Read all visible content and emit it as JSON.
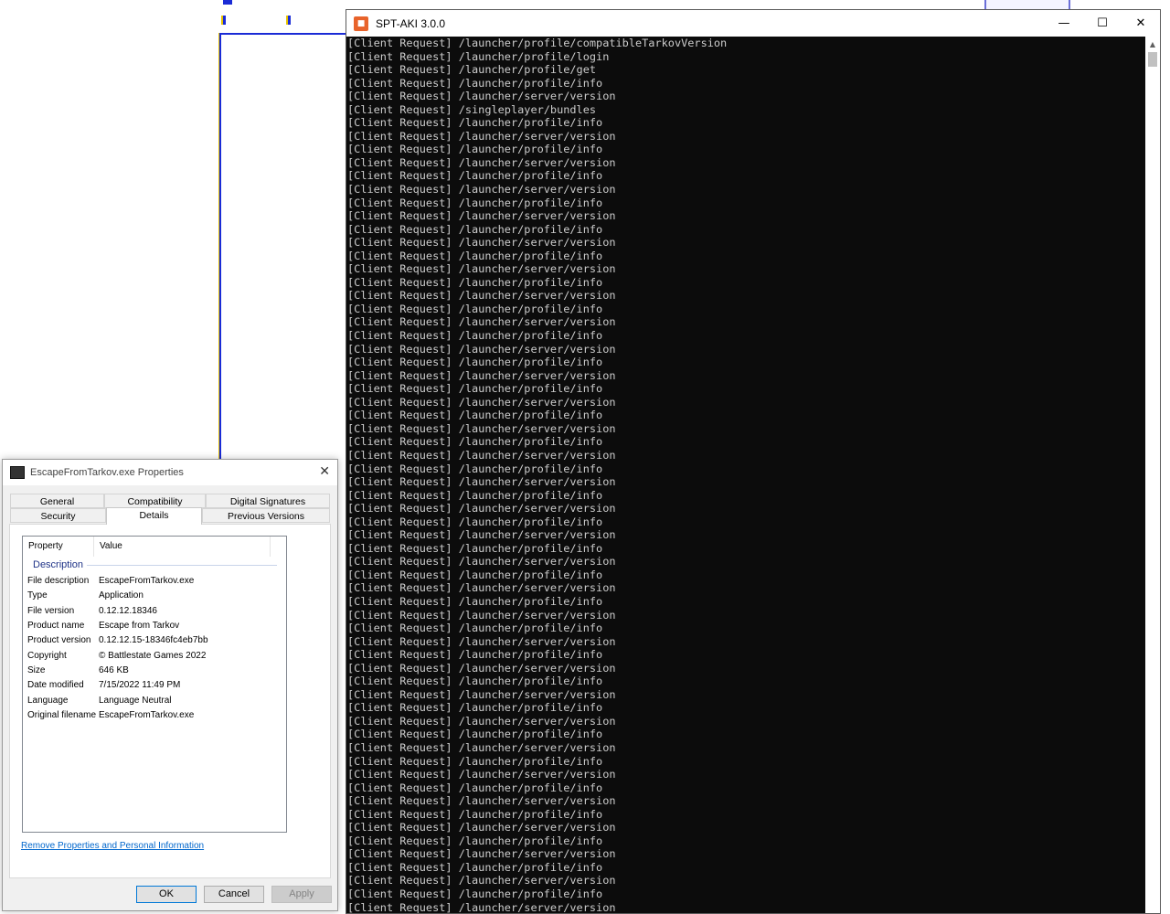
{
  "colors": {
    "console_bg": "#0c0c0c",
    "console_text": "#cccccc",
    "link": "#0066cc",
    "group": "#1e3287"
  },
  "console": {
    "title": "SPT-AKI 3.0.0",
    "icon": "spt-aki-icon",
    "controls": {
      "minimize": "—",
      "maximize": "☐",
      "close": "✕"
    },
    "lines": [
      "[Client Request] /launcher/profile/compatibleTarkovVersion",
      "[Client Request] /launcher/profile/login",
      "[Client Request] /launcher/profile/get",
      "[Client Request] /launcher/profile/info",
      "[Client Request] /launcher/server/version",
      "[Client Request] /singleplayer/bundles",
      "[Client Request] /launcher/profile/info",
      "[Client Request] /launcher/server/version",
      "[Client Request] /launcher/profile/info",
      "[Client Request] /launcher/server/version",
      "[Client Request] /launcher/profile/info",
      "[Client Request] /launcher/server/version",
      "[Client Request] /launcher/profile/info",
      "[Client Request] /launcher/server/version",
      "[Client Request] /launcher/profile/info",
      "[Client Request] /launcher/server/version",
      "[Client Request] /launcher/profile/info",
      "[Client Request] /launcher/server/version",
      "[Client Request] /launcher/profile/info",
      "[Client Request] /launcher/server/version",
      "[Client Request] /launcher/profile/info",
      "[Client Request] /launcher/server/version",
      "[Client Request] /launcher/profile/info",
      "[Client Request] /launcher/server/version",
      "[Client Request] /launcher/profile/info",
      "[Client Request] /launcher/server/version",
      "[Client Request] /launcher/profile/info",
      "[Client Request] /launcher/server/version",
      "[Client Request] /launcher/profile/info",
      "[Client Request] /launcher/server/version",
      "[Client Request] /launcher/profile/info",
      "[Client Request] /launcher/server/version",
      "[Client Request] /launcher/profile/info",
      "[Client Request] /launcher/server/version",
      "[Client Request] /launcher/profile/info",
      "[Client Request] /launcher/server/version",
      "[Client Request] /launcher/profile/info",
      "[Client Request] /launcher/server/version",
      "[Client Request] /launcher/profile/info",
      "[Client Request] /launcher/server/version",
      "[Client Request] /launcher/profile/info",
      "[Client Request] /launcher/server/version",
      "[Client Request] /launcher/profile/info",
      "[Client Request] /launcher/server/version",
      "[Client Request] /launcher/profile/info",
      "[Client Request] /launcher/server/version",
      "[Client Request] /launcher/profile/info",
      "[Client Request] /launcher/server/version",
      "[Client Request] /launcher/profile/info",
      "[Client Request] /launcher/server/version",
      "[Client Request] /launcher/profile/info",
      "[Client Request] /launcher/server/version",
      "[Client Request] /launcher/profile/info",
      "[Client Request] /launcher/server/version",
      "[Client Request] /launcher/profile/info",
      "[Client Request] /launcher/server/version",
      "[Client Request] /launcher/profile/info",
      "[Client Request] /launcher/server/version",
      "[Client Request] /launcher/profile/info",
      "[Client Request] /launcher/server/version",
      "[Client Request] /launcher/profile/info",
      "[Client Request] /launcher/server/version",
      "[Client Request] /launcher/profile/info",
      "[Client Request] /launcher/server/version",
      "[Client Request] /launcher/profile/info",
      "[Client Request] /launcher/server/version",
      "[Client Request] /launcher/profile/info",
      "[Client Request] /launcher/server/version"
    ]
  },
  "properties": {
    "title": "EscapeFromTarkov.exe Properties",
    "close": "✕",
    "tabs_row1": [
      "General",
      "Compatibility",
      "Digital Signatures"
    ],
    "tabs_row2": [
      "Security",
      "Details",
      "Previous Versions"
    ],
    "active_tab": "Details",
    "columns": [
      "Property",
      "Value"
    ],
    "group": "Description",
    "rows": [
      {
        "name": "File description",
        "value": "EscapeFromTarkov.exe"
      },
      {
        "name": "Type",
        "value": "Application"
      },
      {
        "name": "File version",
        "value": "0.12.12.18346"
      },
      {
        "name": "Product name",
        "value": "Escape from Tarkov"
      },
      {
        "name": "Product version",
        "value": "0.12.12.15-18346fc4eb7bb"
      },
      {
        "name": "Copyright",
        "value": "© Battlestate Games 2022"
      },
      {
        "name": "Size",
        "value": "646 KB"
      },
      {
        "name": "Date modified",
        "value": "7/15/2022 11:49 PM"
      },
      {
        "name": "Language",
        "value": "Language Neutral"
      },
      {
        "name": "Original filename",
        "value": "EscapeFromTarkov.exe"
      }
    ],
    "remove_link": "Remove Properties and Personal Information",
    "buttons": {
      "ok": "OK",
      "cancel": "Cancel",
      "apply": "Apply"
    }
  }
}
